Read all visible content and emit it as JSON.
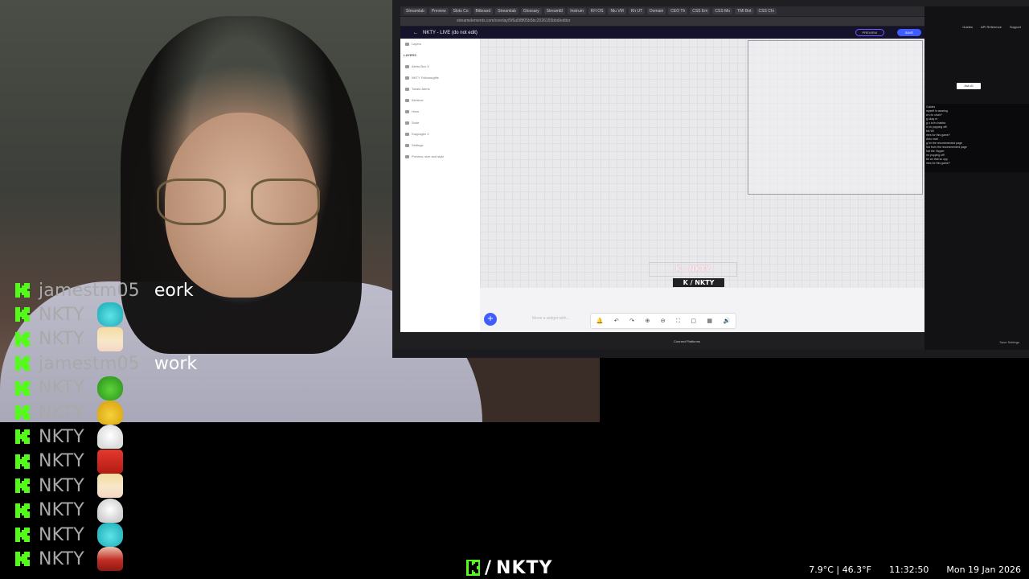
{
  "screen": {
    "browser_tabs": [
      "Streamlab",
      "Preview",
      "Slots Co",
      "Bitboard",
      "Streamlab",
      "Glossary",
      "StreamEl",
      "Instrum",
      "KH OS",
      "Nlu VM",
      "Kh UT",
      "Domain",
      "CEO Th",
      "CSS Em",
      "CSS Mo",
      "TMI Bot",
      "CSS Chi"
    ],
    "address": "streamelements.com/overlay/5f6a5f8f05b5bc2026155bbd/editor",
    "overlay_title": "NKTY - LIVE (do not edit)",
    "preview_label": "PREVIEW",
    "save_label": "SAVE",
    "layers": {
      "header": "Layers",
      "title": "LAYERS",
      "items": [
        "Alerts Box 5",
        "NKTY Follows/gifts",
        "Totalin Alerts",
        "Alertbox",
        "Hrsw",
        "Sode",
        "Kappagen 2",
        "Settings",
        "Preview, size and style"
      ]
    },
    "canvas": {
      "logo_text": "K / NKTY",
      "logo_text_ghost": "K / NKTY"
    },
    "bottom": {
      "add_icon": "+",
      "hint": "Move a widget with...",
      "toolbar_icons": [
        "bell-icon",
        "undo-icon",
        "redo-icon",
        "zoom-in-icon",
        "zoom-out-icon",
        "fit-icon",
        "fullscreen-icon",
        "grid-icon",
        "sound-icon"
      ]
    },
    "right_panel": {
      "nav": [
        "Guides",
        "API Reference",
        "Support"
      ],
      "ask_ai": "Ask AI",
      "chat_lines": "Guides\nmyself is wearing\nw u kr chair?\ng okay m\ng u is fro habba\nn oh popping off!\nbis Wl\nmes for this game?\ndoro mati\ng for the recommended page\nhot from the recommended page\nhat the Yapper\nnn popping off!\nbe an that so opy\nmes for this game?",
      "save_settings": "Save Settings",
      "connect_platforms": "Connect Platforms"
    }
  },
  "chat": [
    {
      "username": "jamestm05",
      "text": "eork",
      "emote": null
    },
    {
      "username": "NKTY",
      "text": "",
      "emote": "cyan-cat"
    },
    {
      "username": "NKTY",
      "text": "",
      "emote": "blonde-anime"
    },
    {
      "username": "jamestm05",
      "text": "work",
      "emote": null
    },
    {
      "username": "NKTY",
      "text": "",
      "emote": "green-blob"
    },
    {
      "username": "NKTY",
      "text": "",
      "emote": "yellow-bird"
    },
    {
      "username": "NKTY",
      "text": "",
      "emote": "white-ghost"
    },
    {
      "username": "NKTY",
      "text": "",
      "emote": "red-face"
    },
    {
      "username": "NKTY",
      "text": "",
      "emote": "blonde-anime"
    },
    {
      "username": "NKTY",
      "text": "",
      "emote": "shades-ghost"
    },
    {
      "username": "NKTY",
      "text": "",
      "emote": "cyan-cat"
    },
    {
      "username": "NKTY",
      "text": "",
      "emote": "red-figure"
    }
  ],
  "colors": {
    "kick_green": "#53fc18",
    "username_gray": "#a9a9a9",
    "se_accent": "#3f5cff"
  },
  "footer": {
    "slash": "/",
    "name": "NKTY"
  },
  "status": {
    "temperature": "7.9°C | 46.3°F",
    "time": "11:32:50",
    "date": "Mon 19 Jan 2026"
  }
}
